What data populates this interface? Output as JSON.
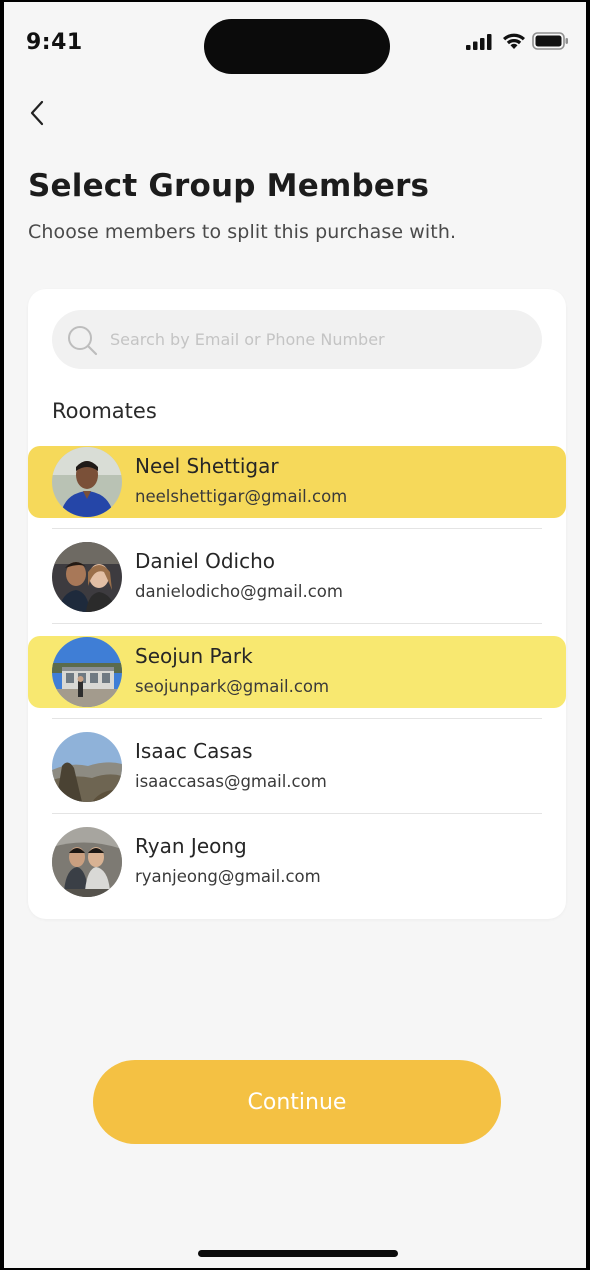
{
  "status_bar": {
    "time": "9:41"
  },
  "header": {
    "title": "Select Group Members",
    "subtitle": "Choose members to split this purchase with."
  },
  "search": {
    "placeholder": "Search by Email or Phone Number",
    "value": ""
  },
  "section": {
    "label": "Roomates"
  },
  "members": [
    {
      "name": "Neel Shettigar",
      "email": "neelshettigar@gmail.com",
      "selected": true,
      "highlight": "#f6d95a"
    },
    {
      "name": "Daniel Odicho",
      "email": "danielodicho@gmail.com",
      "selected": false
    },
    {
      "name": "Seojun Park",
      "email": "seojunpark@gmail.com",
      "selected": true,
      "highlight": "#f8e870"
    },
    {
      "name": "Isaac Casas",
      "email": "isaaccasas@gmail.com",
      "selected": false
    },
    {
      "name": "Ryan Jeong",
      "email": "ryanjeong@gmail.com",
      "selected": false
    }
  ],
  "continue_button": {
    "label": "Continue",
    "color": "#f4c143"
  },
  "icons": {
    "back": "chevron-left-icon",
    "search": "search-icon",
    "signal": "cellular-signal-icon",
    "wifi": "wifi-icon",
    "battery": "battery-icon"
  },
  "colors": {
    "background": "#f6f6f6",
    "card": "#ffffff",
    "accent": "#f4c143"
  }
}
